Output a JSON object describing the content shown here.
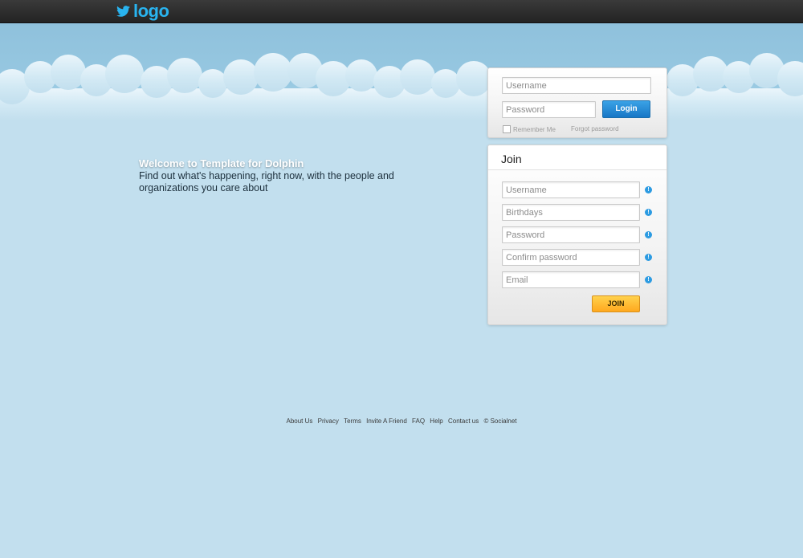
{
  "header": {
    "logo_text": "logo"
  },
  "welcome": {
    "title": "Welcome to Template for Dolphin",
    "subtitle": "Find out what's happening, right now, with the people and organizations you care about"
  },
  "login": {
    "username_placeholder": "Username",
    "password_placeholder": "Password",
    "login_button": "Login",
    "remember_me": "Remember Me",
    "forgot_password": "Forgot password"
  },
  "join": {
    "title": "Join",
    "fields": [
      {
        "placeholder": "Username"
      },
      {
        "placeholder": "Birthdays"
      },
      {
        "placeholder": "Password"
      },
      {
        "placeholder": "Confirm password"
      },
      {
        "placeholder": "Email"
      }
    ],
    "join_button": "JOIN"
  },
  "footer": {
    "links": [
      "About Us",
      "Privacy",
      "Terms",
      "Invite A Friend",
      "FAQ",
      "Help",
      "Contact us"
    ],
    "copyright": "© Socialnet"
  },
  "colors": {
    "background": "#c2dfee",
    "topbar": "#2a2a2a",
    "logo_blue": "#29b4f0",
    "login_button": "#1f83d0",
    "join_button": "#ffb52b"
  }
}
